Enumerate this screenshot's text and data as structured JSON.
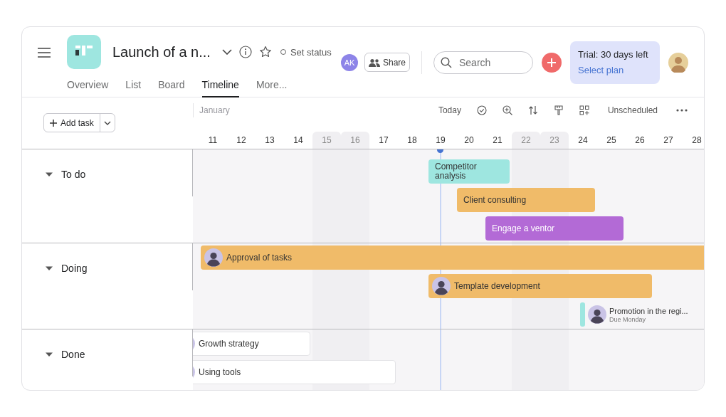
{
  "header": {
    "title": "Launch of a n...",
    "status": "Set status",
    "member_initials": "AK",
    "share": "Share",
    "search": {
      "placeholder": "Search"
    },
    "trial": {
      "text": "Trial: 30 days left",
      "link": "Select plan"
    }
  },
  "tabs": [
    {
      "label": "Overview",
      "selected": false
    },
    {
      "label": "List",
      "selected": false
    },
    {
      "label": "Board",
      "selected": false
    },
    {
      "label": "Timeline",
      "selected": true
    },
    {
      "label": "More...",
      "selected": false
    }
  ],
  "timeline": {
    "add_task": "Add task",
    "month": "January",
    "today_button": "Today",
    "unscheduled": "Unscheduled",
    "days": [
      {
        "label": "11",
        "weekend": false,
        "today": false
      },
      {
        "label": "12",
        "weekend": false,
        "today": false
      },
      {
        "label": "13",
        "weekend": false,
        "today": false
      },
      {
        "label": "14",
        "weekend": false,
        "today": false
      },
      {
        "label": "15",
        "weekend": true,
        "today": false
      },
      {
        "label": "16",
        "weekend": true,
        "today": false
      },
      {
        "label": "17",
        "weekend": false,
        "today": false
      },
      {
        "label": "18",
        "weekend": false,
        "today": false
      },
      {
        "label": "19",
        "weekend": false,
        "today": true
      },
      {
        "label": "20",
        "weekend": false,
        "today": false
      },
      {
        "label": "21",
        "weekend": false,
        "today": false
      },
      {
        "label": "22",
        "weekend": true,
        "today": false
      },
      {
        "label": "23",
        "weekend": true,
        "today": false
      },
      {
        "label": "24",
        "weekend": false,
        "today": false
      },
      {
        "label": "25",
        "weekend": false,
        "today": false
      },
      {
        "label": "26",
        "weekend": false,
        "today": false
      },
      {
        "label": "27",
        "weekend": false,
        "today": false
      },
      {
        "label": "28",
        "weekend": false,
        "today": false
      }
    ],
    "groups": [
      {
        "name": "To do",
        "expanded": true,
        "tasks": [
          {
            "kind": "bar",
            "title": "Competitor analysis",
            "color": "#9ee6e0",
            "avatar": false
          },
          {
            "kind": "bar",
            "title": "Client consulting",
            "color": "#f0bb69",
            "avatar": false
          },
          {
            "kind": "bar",
            "title": "Engage a ventor",
            "color": "#b36ad6",
            "avatar": false
          }
        ]
      },
      {
        "name": "Doing",
        "expanded": true,
        "tasks": [
          {
            "kind": "bar",
            "title": "Approval of tasks",
            "color": "#f0bb69",
            "avatar": true
          },
          {
            "kind": "bar",
            "title": "Template development",
            "color": "#f0bb69",
            "avatar": true
          },
          {
            "kind": "due",
            "title": "Promotion in the regi...",
            "subtitle": "Due Monday",
            "color": "#9ee6e0",
            "avatar": true
          }
        ]
      },
      {
        "name": "Done",
        "expanded": true,
        "tasks": [
          {
            "kind": "bar",
            "title": "Growth strategy",
            "color": "#ffffff",
            "avatar": true
          },
          {
            "kind": "bar",
            "title": "Using tools",
            "color": "#ffffff",
            "avatar": true
          }
        ]
      }
    ]
  }
}
